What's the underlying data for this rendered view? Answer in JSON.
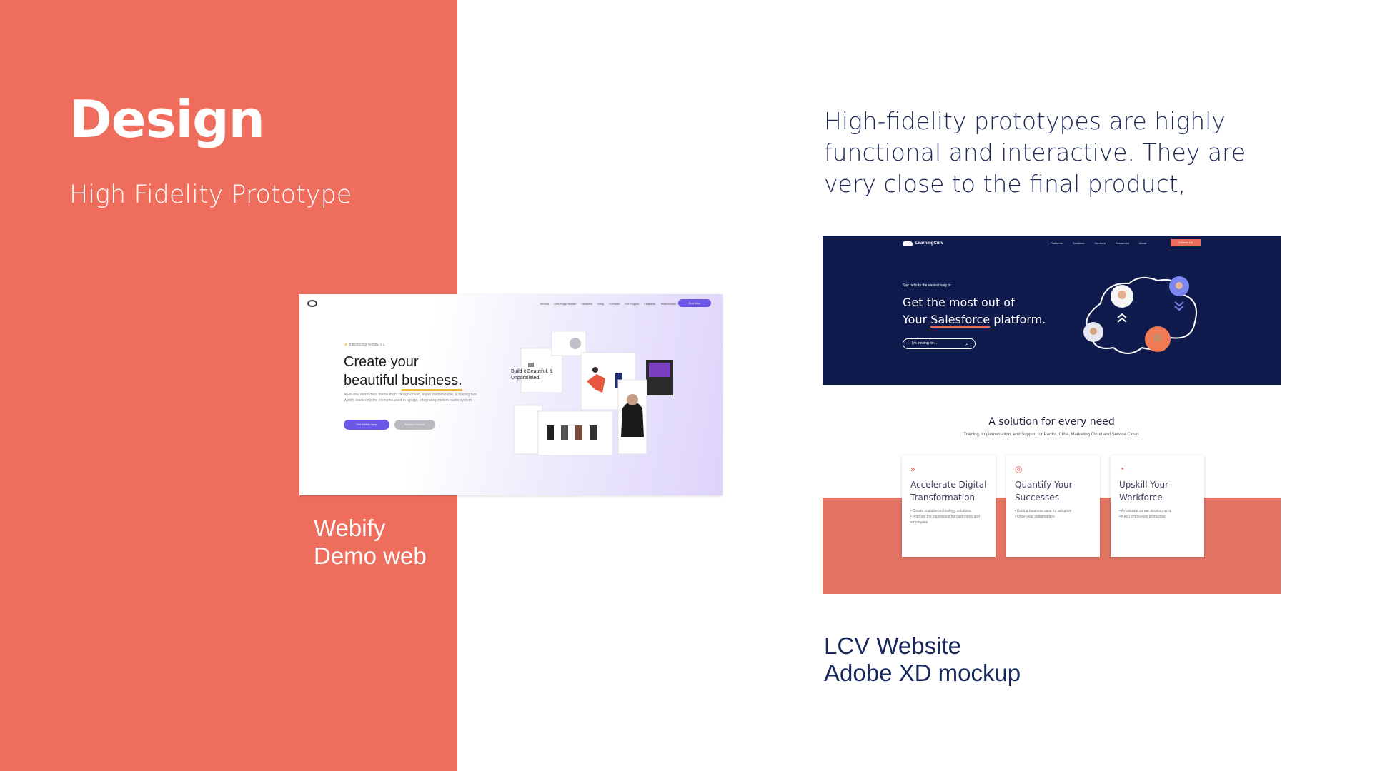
{
  "slide": {
    "title": "Design",
    "subtitle": "High Fidelity Prototype",
    "intro": "High-fidelity prototypes are highly functional and interactive. They are very close to the final product,",
    "caption_webify_line1": "Webify",
    "caption_webify_line2": "Demo web",
    "caption_lcv_line1": "LCV Website",
    "caption_lcv_line2": "Adobe XD mockup",
    "colors": {
      "coral": "#ef6d5d",
      "navy": "#0f1b4c",
      "accent_purple": "#6b57e8"
    }
  },
  "webify": {
    "nav": [
      "Demos",
      "One Page Builder",
      "Headers",
      "Shop",
      "Portfolio",
      "For Plugins",
      "Features",
      "Testimonials"
    ],
    "buy_label": "Buy Now",
    "intro_label": "Introducing Webify 3.1",
    "heading_line1": "Create your",
    "heading_line2a": "beautiful ",
    "heading_line2b": "business.",
    "paragraph": "All-in-one WordPress theme that's design-driven, super customizable, & blazing fast. Webify loads only the elements used in a page, integrating custom cache system.",
    "btn_primary": "Get Webify Now",
    "btn_secondary": "Browse Demos",
    "card_text": "Build it Beautiful, & Unparalleled."
  },
  "lcv": {
    "brand": "LearningCurv",
    "nav": [
      "Platforms",
      "Solutions",
      "Services",
      "Resources",
      "About"
    ],
    "contact_label": "Contact Us",
    "hello": "Say hello to the easiest way to...",
    "headline_line1": "Get the most out of",
    "headline_line2a": "Your ",
    "headline_line2b": "Salesforce",
    "headline_line2c": " platform.",
    "search_placeholder": "I'm looking for...",
    "solutions_title": "A solution for every need",
    "solutions_sub": "Training, Implementation, and Support for Pardot, CRM, Marketing Cloud and Service Cloud.",
    "cards": [
      {
        "icon": "double-chevron-icon",
        "glyph": "»",
        "name": "Accelerate Digital Transformation",
        "bullets": [
          "• Create scalable technology solutions",
          "• Improve the experience for customers and employees"
        ]
      },
      {
        "icon": "target-icon",
        "glyph": "◎",
        "name": "Quantify Your Successes",
        "bullets": [
          "• Build a business case for adoption",
          "• Unite your stakeholders"
        ]
      },
      {
        "icon": "growth-icon",
        "glyph": "◔",
        "name": "Upskill Your Workforce",
        "bullets": [
          "• Accelerate career development",
          "• Keep employees productive"
        ]
      }
    ]
  }
}
